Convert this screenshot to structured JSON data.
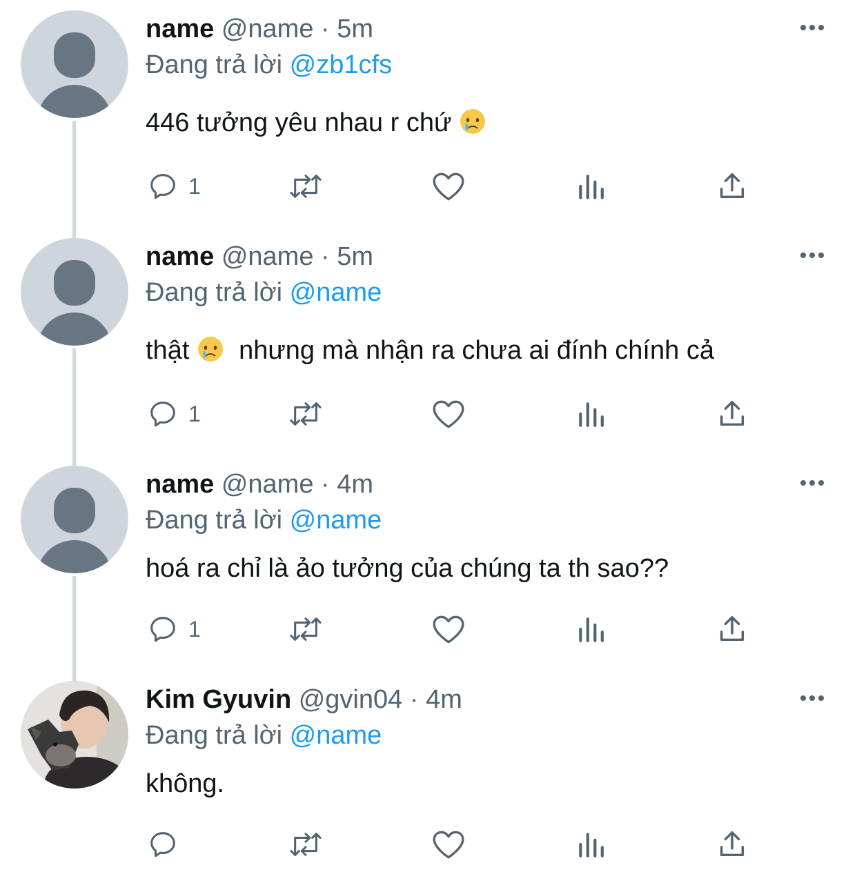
{
  "reply_prefix": "Đang trả lời",
  "icons": [
    "reply-icon",
    "retweet-icon",
    "like-icon",
    "views-icon",
    "share-icon",
    "more-icon"
  ],
  "colors": {
    "text": "#0f1419",
    "secondary": "#536471",
    "link": "#1d9bf0",
    "thread_line": "#cfd9de",
    "avatar_bg": "#ced5dc"
  },
  "tweets": [
    {
      "name": "name",
      "handle": "@name",
      "dot": "·",
      "time": "5m",
      "reply_to": "@zb1cfs",
      "text_before": "446 tưởng yêu nhau r chứ ",
      "emoji": "😢",
      "text_after": "",
      "reply_count": "1"
    },
    {
      "name": "name",
      "handle": "@name",
      "dot": "·",
      "time": "5m",
      "reply_to": "@name",
      "text_before": "thật ",
      "emoji": "😢",
      "text_after": "  nhưng mà nhận ra chưa ai đính chính cả",
      "reply_count": "1"
    },
    {
      "name": "name",
      "handle": "@name",
      "dot": "·",
      "time": "4m",
      "reply_to": "@name",
      "text_before": "hoá ra chỉ là ảo tưởng của chúng ta th sao??",
      "emoji": "",
      "text_after": "",
      "reply_count": "1"
    },
    {
      "name": "Kim Gyuvin",
      "handle": "@gvin04",
      "dot": "·",
      "time": "4m",
      "reply_to": "@name",
      "text_before": "không.",
      "emoji": "",
      "text_after": "",
      "reply_count": ""
    }
  ]
}
